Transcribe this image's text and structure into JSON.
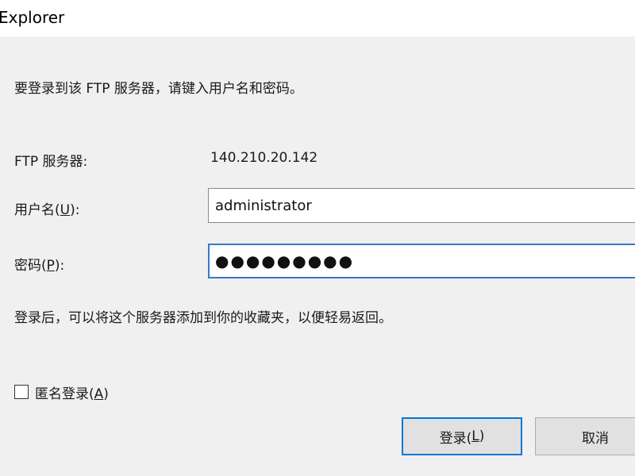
{
  "window": {
    "title": "Explorer"
  },
  "dialog": {
    "instruction": "要登录到该 FTP 服务器，请键入用户名和密码。",
    "server_label": "FTP 服务器:",
    "server_value": "140.210.20.142",
    "username_label_pre": "用户名(",
    "username_label_key": "U",
    "username_label_post": "):",
    "username_value": "administrator",
    "password_label_pre": "密码(",
    "password_label_key": "P",
    "password_label_post": "):",
    "password_value": "●●●●●●●●●",
    "after_login_note": "登录后，可以将这个服务器添加到你的收藏夹，以便轻易返回。",
    "anonymous_label_pre": "匿名登录(",
    "anonymous_label_key": "A",
    "anonymous_label_post": ")",
    "anonymous_checked": false,
    "login_button_pre": "登录(",
    "login_button_key": "L",
    "login_button_post": ")",
    "cancel_button": "取消"
  },
  "colors": {
    "focus_border": "#0078d7",
    "dialog_background": "#f0f0f0"
  }
}
